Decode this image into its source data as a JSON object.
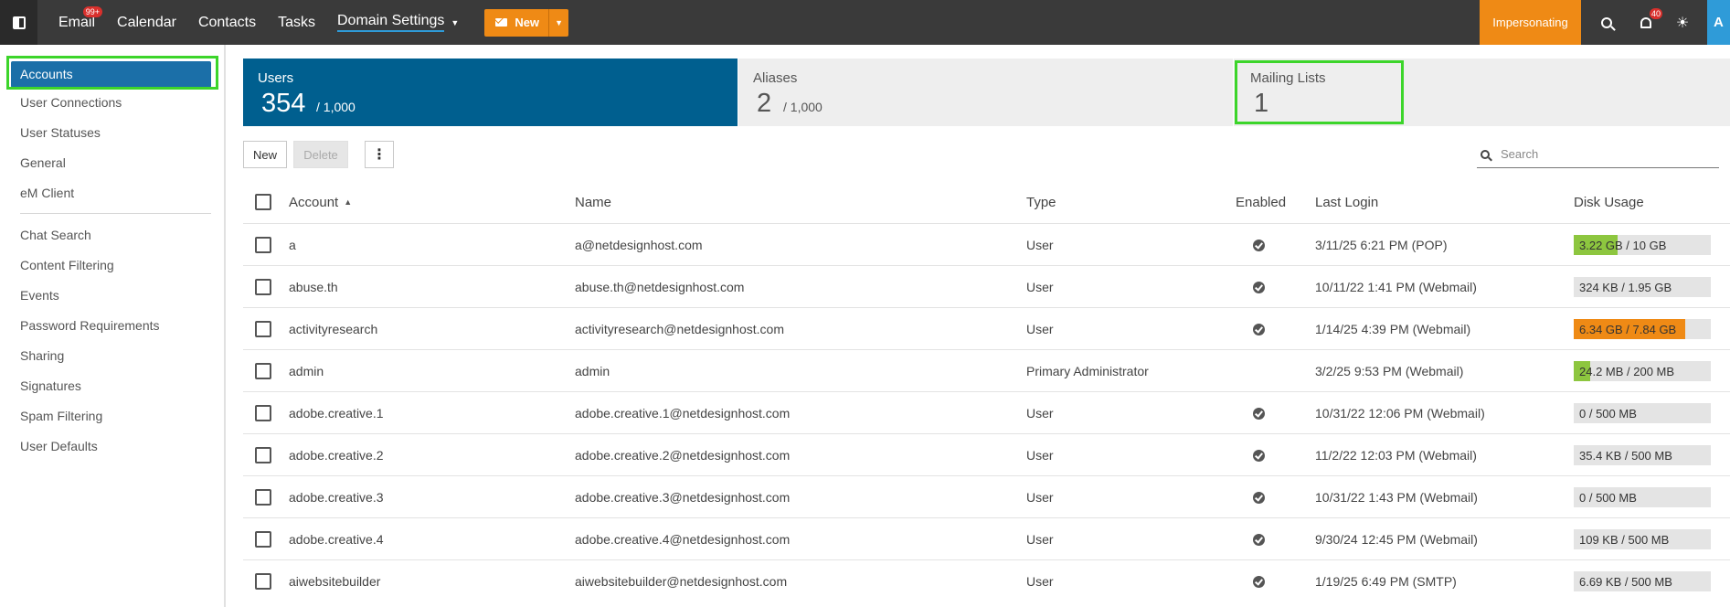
{
  "topbar": {
    "nav": [
      {
        "label": "Email",
        "badge": "99+"
      },
      {
        "label": "Calendar"
      },
      {
        "label": "Contacts"
      },
      {
        "label": "Tasks"
      },
      {
        "label": "Domain Settings",
        "active": true
      }
    ],
    "new_label": "New",
    "impersonating_label": "Impersonating",
    "notification_count": "40",
    "avatar_initial": "A"
  },
  "sidebar": {
    "items": [
      "Accounts",
      "User Connections",
      "User Statuses",
      "General",
      "eM Client",
      "Chat Search",
      "Content Filtering",
      "Events",
      "Password Requirements",
      "Sharing",
      "Signatures",
      "Spam Filtering",
      "User Defaults"
    ],
    "active_index": 0
  },
  "cards": {
    "users": {
      "title": "Users",
      "value": "354",
      "max": "/ 1,000"
    },
    "aliases": {
      "title": "Aliases",
      "value": "2",
      "max": "/ 1,000"
    },
    "lists": {
      "title": "Mailing Lists",
      "value": "1"
    }
  },
  "toolbar": {
    "new_label": "New",
    "delete_label": "Delete",
    "more_label": "⋮",
    "search_placeholder": "Search"
  },
  "table": {
    "headers": {
      "account": "Account",
      "name": "Name",
      "type": "Type",
      "enabled": "Enabled",
      "last_login": "Last Login",
      "disk_usage": "Disk Usage"
    },
    "rows": [
      {
        "account": "a",
        "name": "a@netdesignhost.com",
        "type": "User",
        "enabled": true,
        "last_login": "3/11/25 6:21 PM (POP)",
        "disk": "3.22 GB / 10 GB",
        "disk_pct": 32,
        "disk_color": "#8dc63f"
      },
      {
        "account": "abuse.th",
        "name": "abuse.th@netdesignhost.com",
        "type": "User",
        "enabled": true,
        "last_login": "10/11/22 1:41 PM (Webmail)",
        "disk": "324 KB / 1.95 GB",
        "disk_pct": 0,
        "disk_color": "#8dc63f"
      },
      {
        "account": "activityresearch",
        "name": "activityresearch@netdesignhost.com",
        "type": "User",
        "enabled": true,
        "last_login": "1/14/25 4:39 PM (Webmail)",
        "disk": "6.34 GB / 7.84 GB",
        "disk_pct": 81,
        "disk_color": "#ef8a15"
      },
      {
        "account": "admin",
        "name": "admin",
        "type": "Primary Administrator",
        "enabled": false,
        "last_login": "3/2/25 9:53 PM (Webmail)",
        "disk": "24.2 MB / 200 MB",
        "disk_pct": 12,
        "disk_color": "#8dc63f"
      },
      {
        "account": "adobe.creative.1",
        "name": "adobe.creative.1@netdesignhost.com",
        "type": "User",
        "enabled": true,
        "last_login": "10/31/22 12:06 PM (Webmail)",
        "disk": "0 / 500 MB",
        "disk_pct": 0,
        "disk_color": "#8dc63f"
      },
      {
        "account": "adobe.creative.2",
        "name": "adobe.creative.2@netdesignhost.com",
        "type": "User",
        "enabled": true,
        "last_login": "11/2/22 12:03 PM (Webmail)",
        "disk": "35.4 KB / 500 MB",
        "disk_pct": 0,
        "disk_color": "#8dc63f"
      },
      {
        "account": "adobe.creative.3",
        "name": "adobe.creative.3@netdesignhost.com",
        "type": "User",
        "enabled": true,
        "last_login": "10/31/22 1:43 PM (Webmail)",
        "disk": "0 / 500 MB",
        "disk_pct": 0,
        "disk_color": "#8dc63f"
      },
      {
        "account": "adobe.creative.4",
        "name": "adobe.creative.4@netdesignhost.com",
        "type": "User",
        "enabled": true,
        "last_login": "9/30/24 12:45 PM (Webmail)",
        "disk": "109 KB / 500 MB",
        "disk_pct": 0,
        "disk_color": "#8dc63f"
      },
      {
        "account": "aiwebsitebuilder",
        "name": "aiwebsitebuilder@netdesignhost.com",
        "type": "User",
        "enabled": true,
        "last_login": "1/19/25 6:49 PM (SMTP)",
        "disk": "6.69 KB / 500 MB",
        "disk_pct": 0,
        "disk_color": "#8dc63f"
      }
    ]
  }
}
